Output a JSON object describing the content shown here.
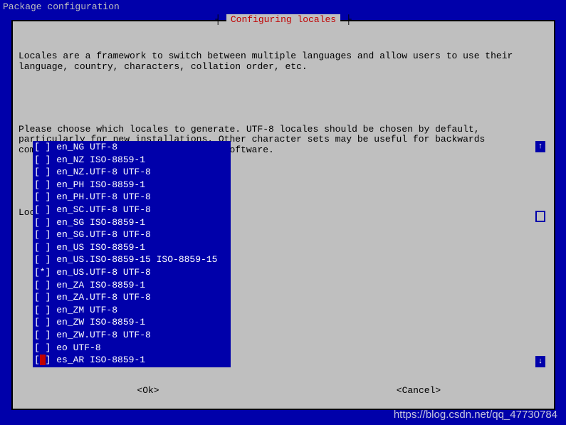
{
  "header": "Package configuration",
  "dialog": {
    "title": "Configuring locales",
    "para1": "Locales are a framework to switch between multiple languages and allow users to use their language, country, characters, collation order, etc.",
    "para2": "Please choose which locales to generate. UTF-8 locales should be chosen by default, particularly for new installations. Other character sets may be useful for backwards compatibility with older systems and software.",
    "prompt": "Locales to be generated:",
    "ok": "<Ok>",
    "cancel": "<Cancel>"
  },
  "scroll": {
    "up": "↑",
    "down": "↓"
  },
  "locales": [
    {
      "checked": false,
      "cursor": false,
      "label": "en_NG UTF-8"
    },
    {
      "checked": false,
      "cursor": false,
      "label": "en_NZ ISO-8859-1"
    },
    {
      "checked": false,
      "cursor": false,
      "label": "en_NZ.UTF-8 UTF-8"
    },
    {
      "checked": false,
      "cursor": false,
      "label": "en_PH ISO-8859-1"
    },
    {
      "checked": false,
      "cursor": false,
      "label": "en_PH.UTF-8 UTF-8"
    },
    {
      "checked": false,
      "cursor": false,
      "label": "en_SC.UTF-8 UTF-8"
    },
    {
      "checked": false,
      "cursor": false,
      "label": "en_SG ISO-8859-1"
    },
    {
      "checked": false,
      "cursor": false,
      "label": "en_SG.UTF-8 UTF-8"
    },
    {
      "checked": false,
      "cursor": false,
      "label": "en_US ISO-8859-1"
    },
    {
      "checked": false,
      "cursor": false,
      "label": "en_US.ISO-8859-15 ISO-8859-15"
    },
    {
      "checked": true,
      "cursor": false,
      "label": "en_US.UTF-8 UTF-8"
    },
    {
      "checked": false,
      "cursor": false,
      "label": "en_ZA ISO-8859-1"
    },
    {
      "checked": false,
      "cursor": false,
      "label": "en_ZA.UTF-8 UTF-8"
    },
    {
      "checked": false,
      "cursor": false,
      "label": "en_ZM UTF-8"
    },
    {
      "checked": false,
      "cursor": false,
      "label": "en_ZW ISO-8859-1"
    },
    {
      "checked": false,
      "cursor": false,
      "label": "en_ZW.UTF-8 UTF-8"
    },
    {
      "checked": false,
      "cursor": false,
      "label": "eo UTF-8"
    },
    {
      "checked": false,
      "cursor": true,
      "label": "es_AR ISO-8859-1"
    }
  ],
  "watermark": "https://blog.csdn.net/qq_47730784"
}
